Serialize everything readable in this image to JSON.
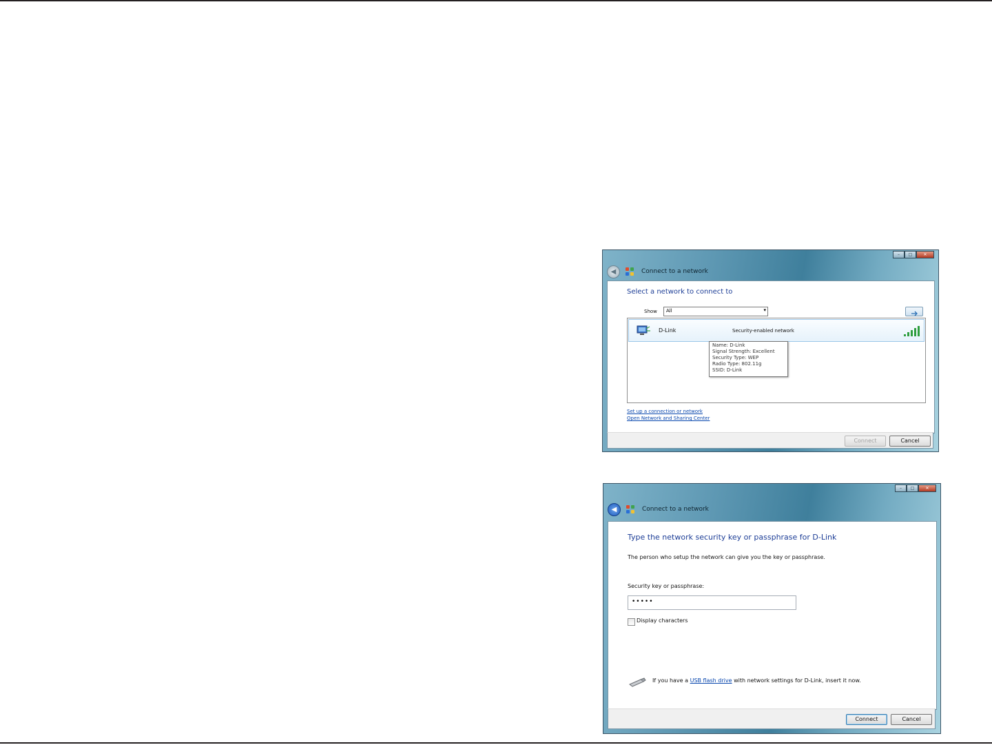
{
  "page": {
    "accent_color": "#1c3d96",
    "link_color": "#0645ad"
  },
  "window_controls": {
    "minimize": "–",
    "maximize": "□",
    "close": "✕"
  },
  "dialog1": {
    "title": "Connect to a network",
    "heading": "Select a network to connect to",
    "show_label": "Show",
    "show_value": "All",
    "refresh_icon": "refresh-icon",
    "network": {
      "name": "D-Link",
      "status": "Security-enabled network",
      "signal_icon": "signal-strength-icon"
    },
    "tooltip": {
      "name": "Name: D-Link",
      "signal": "Signal Strength: Excellent",
      "security": "Security Type: WEP",
      "radio": "Radio Type: 802.11g",
      "ssid": "SSID: D-Link"
    },
    "links": {
      "setup": "Set up a connection or network",
      "open_center": "Open Network and Sharing Center"
    },
    "buttons": {
      "connect": "Connect",
      "cancel": "Cancel"
    }
  },
  "dialog2": {
    "title": "Connect to a network",
    "heading": "Type the network security key or passphrase for D-Link",
    "description": "The person who setup the network can give you the key or passphrase.",
    "key_label": "Security key or passphrase:",
    "key_value": "•••••",
    "display_label": "Display characters",
    "display_checked": false,
    "usb_prefix": "If you have a",
    "usb_link": "USB flash drive",
    "usb_suffix": "with network settings for D-Link, insert it now.",
    "buttons": {
      "connect": "Connect",
      "cancel": "Cancel"
    }
  }
}
